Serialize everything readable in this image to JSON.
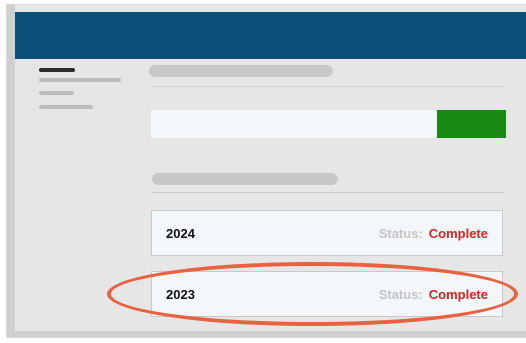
{
  "search": {
    "value": "",
    "placeholder": ""
  },
  "records": [
    {
      "year": "2024",
      "status_label": "Status:",
      "status_value": "Complete"
    },
    {
      "year": "2023",
      "status_label": "Status:",
      "status_value": "Complete"
    }
  ],
  "colors": {
    "header": "#0b5078",
    "button": "#188a12",
    "status_value": "#d72222",
    "highlight": "#e86241"
  }
}
